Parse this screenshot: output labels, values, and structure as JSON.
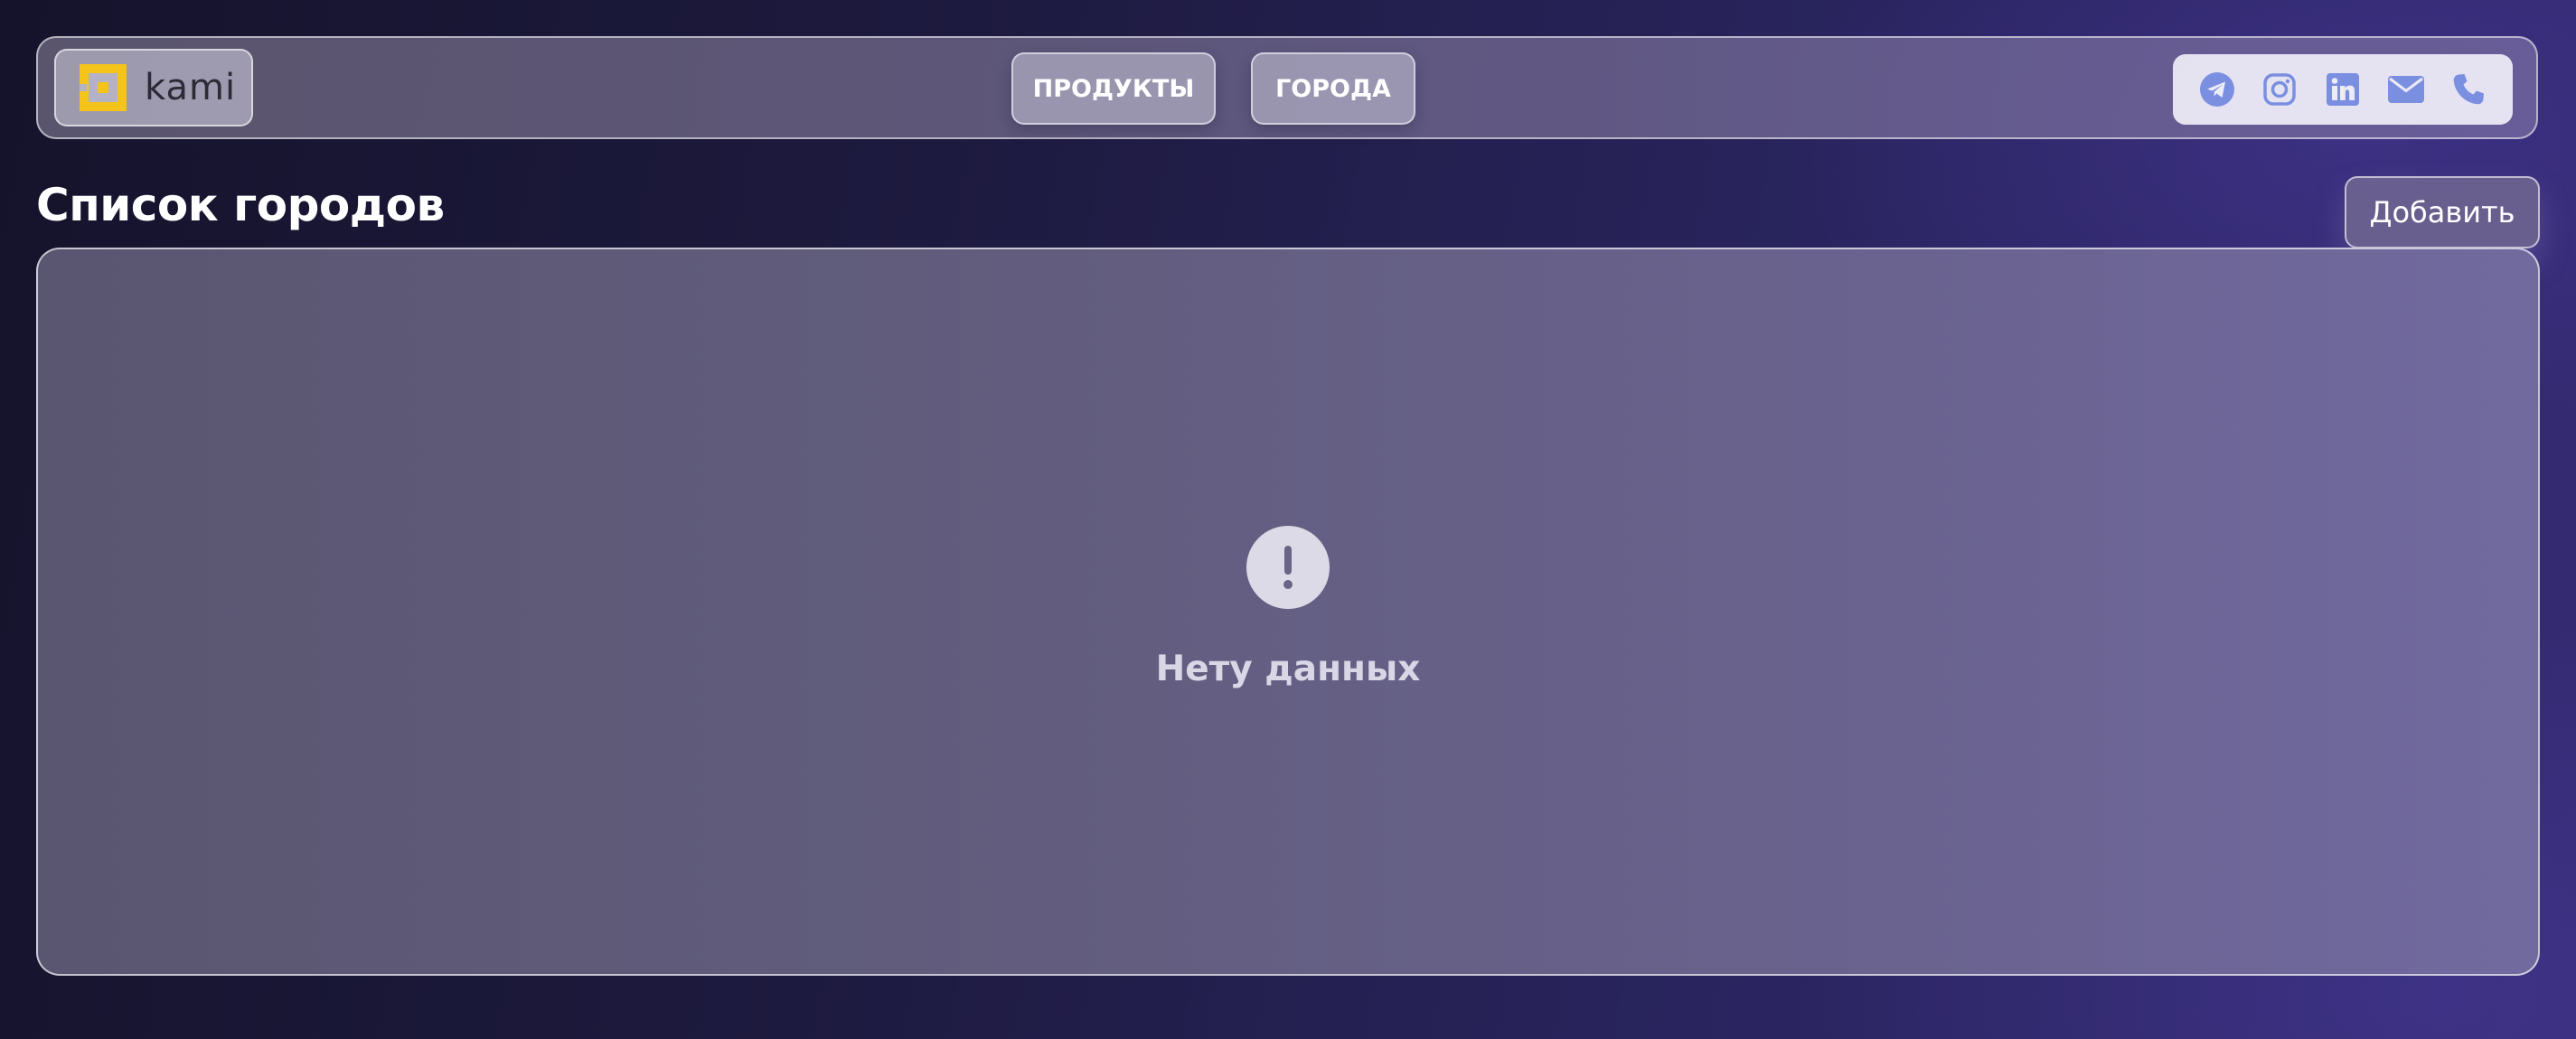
{
  "header": {
    "logo_text": "kami",
    "logo_icon": "kami-logo-icon",
    "nav": [
      {
        "label": "ПРОДУКТЫ"
      },
      {
        "label": "ГОРОДА"
      }
    ],
    "social": [
      {
        "icon": "telegram-icon"
      },
      {
        "icon": "instagram-icon"
      },
      {
        "icon": "linkedin-icon"
      },
      {
        "icon": "mail-icon"
      },
      {
        "icon": "phone-icon"
      }
    ]
  },
  "page": {
    "title": "Список городов",
    "add_label": "Добавить"
  },
  "empty_state": {
    "icon": "exclamation-icon",
    "message": "Нету данных"
  },
  "colors": {
    "logo_accent": "#f4c41a",
    "social_icon": "#7b8fe0",
    "empty_icon_bg": "#dcdae6"
  }
}
